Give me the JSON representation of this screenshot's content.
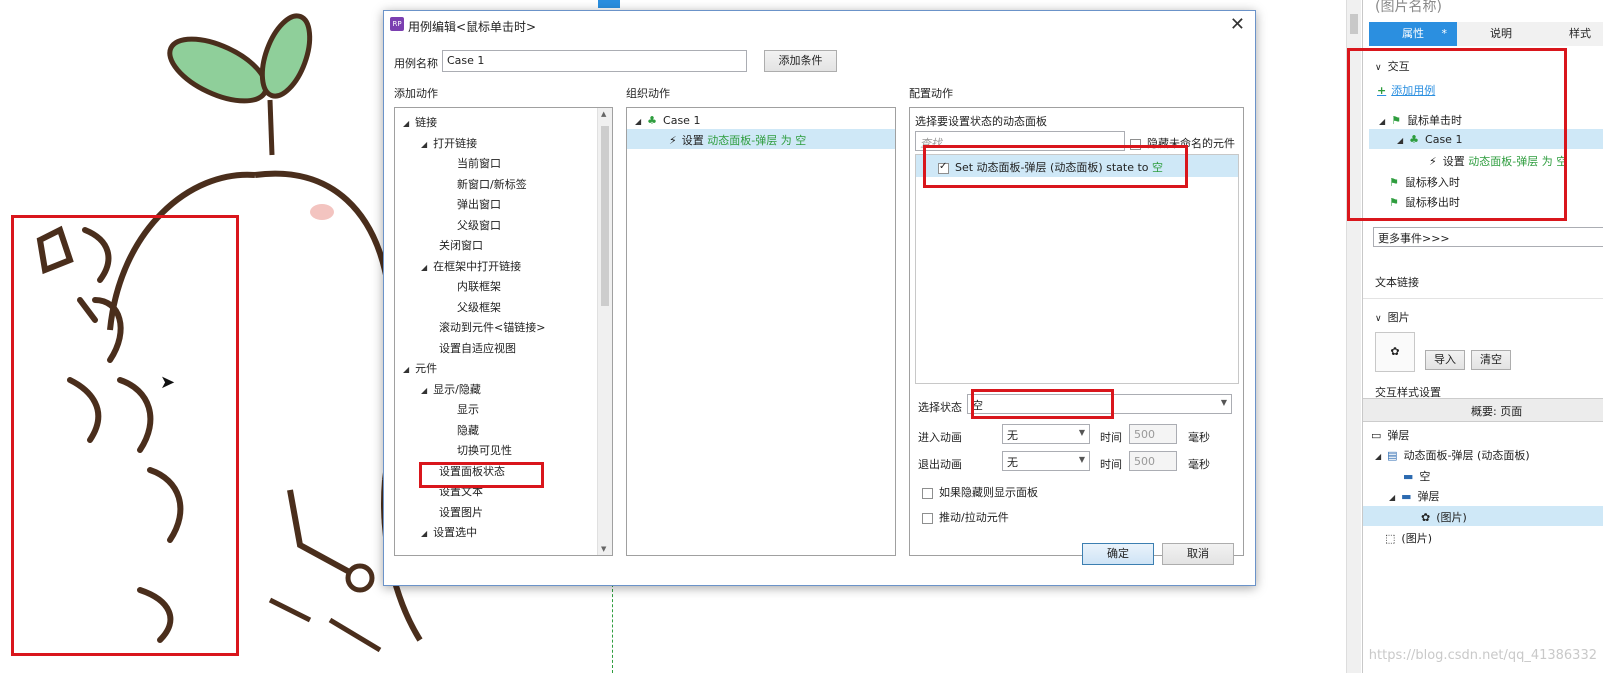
{
  "dialog": {
    "title": "用例编辑<鼠标单击时>",
    "case_name_label": "用例名称",
    "case_name_value": "Case 1",
    "add_condition_button": "添加条件",
    "add_action_header": "添加动作",
    "organize_header": "组织动作",
    "config_header": "配置动作",
    "ok_button": "确定",
    "cancel_button": "取消"
  },
  "add_actions_tree": [
    {
      "label": "链接",
      "level": 0,
      "expanded": true
    },
    {
      "label": "打开链接",
      "level": 1,
      "expanded": true
    },
    {
      "label": "当前窗口",
      "level": 2
    },
    {
      "label": "新窗口/新标签",
      "level": 2
    },
    {
      "label": "弹出窗口",
      "level": 2
    },
    {
      "label": "父级窗口",
      "level": 2
    },
    {
      "label": "关闭窗口",
      "level": 1
    },
    {
      "label": "在框架中打开链接",
      "level": 1,
      "expanded": true
    },
    {
      "label": "内联框架",
      "level": 2
    },
    {
      "label": "父级框架",
      "level": 2
    },
    {
      "label": "滚动到元件<锚链接>",
      "level": 1
    },
    {
      "label": "设置自适应视图",
      "level": 1
    },
    {
      "label": "元件",
      "level": 0,
      "expanded": true
    },
    {
      "label": "显示/隐藏",
      "level": 1,
      "expanded": true
    },
    {
      "label": "显示",
      "level": 2
    },
    {
      "label": "隐藏",
      "level": 2
    },
    {
      "label": "切换可见性",
      "level": 2
    },
    {
      "label": "设置面板状态",
      "level": 1,
      "highlight": true
    },
    {
      "label": "设置文本",
      "level": 1
    },
    {
      "label": "设置图片",
      "level": 1
    },
    {
      "label": "设置选中",
      "level": 1,
      "expanded": true
    }
  ],
  "organize": {
    "case_label": "Case 1",
    "action_prefix": "设置",
    "action_target": "动态面板-弹层 为 空"
  },
  "config": {
    "choose_panel_label": "选择要设置状态的动态面板",
    "search_placeholder": "查找",
    "hide_unnamed_label": "隐藏未命名的元件",
    "panel_row_prefix": "Set 动态面板-弹层 (动态面板) state to ",
    "panel_row_state": "空",
    "select_state_label": "选择状态",
    "select_state_value": "空",
    "enter_anim_label": "进入动画",
    "enter_anim_value": "无",
    "exit_anim_label": "退出动画",
    "exit_anim_value": "无",
    "time_label": "时间",
    "time_value": "500",
    "ms_label": "毫秒",
    "show_if_hidden_label": "如果隐藏则显示面板",
    "push_pull_label": "推动/拉动元件"
  },
  "right_panel": {
    "top_title": "(图片名称)",
    "tabs": [
      "属性",
      "说明",
      "样式"
    ],
    "interaction_header": "交互",
    "add_case_link": "添加用例",
    "events": [
      {
        "label": "鼠标单击时",
        "level": 0
      },
      {
        "label": "Case 1",
        "level": 1
      },
      {
        "label": "设置",
        "target": "动态面板-弹层 为 空",
        "level": 2
      },
      {
        "label": "鼠标移入时",
        "level": 0
      },
      {
        "label": "鼠标移出时",
        "level": 0
      }
    ],
    "more_events": "更多事件>>>",
    "text_link_label": "文本链接",
    "image_header": "图片",
    "import_button": "导入",
    "clear_button": "清空",
    "interaction_style_label": "交互样式设置",
    "outline_header": "概要: 页面",
    "outline_items": [
      {
        "label": "弹层",
        "level": 0
      },
      {
        "label": "动态面板-弹层 (动态面板)",
        "level": 0
      },
      {
        "label": "空",
        "level": 1
      },
      {
        "label": "弹层",
        "level": 1
      },
      {
        "label": "(图片)",
        "level": 2
      },
      {
        "label": "(图片)",
        "level": 0
      }
    ]
  },
  "watermark": "https://blog.csdn.net/qq_41386332",
  "colors": {
    "accent": "#2b8fe0",
    "highlight_red": "#d9161c",
    "green_text": "#2e9d3e"
  }
}
